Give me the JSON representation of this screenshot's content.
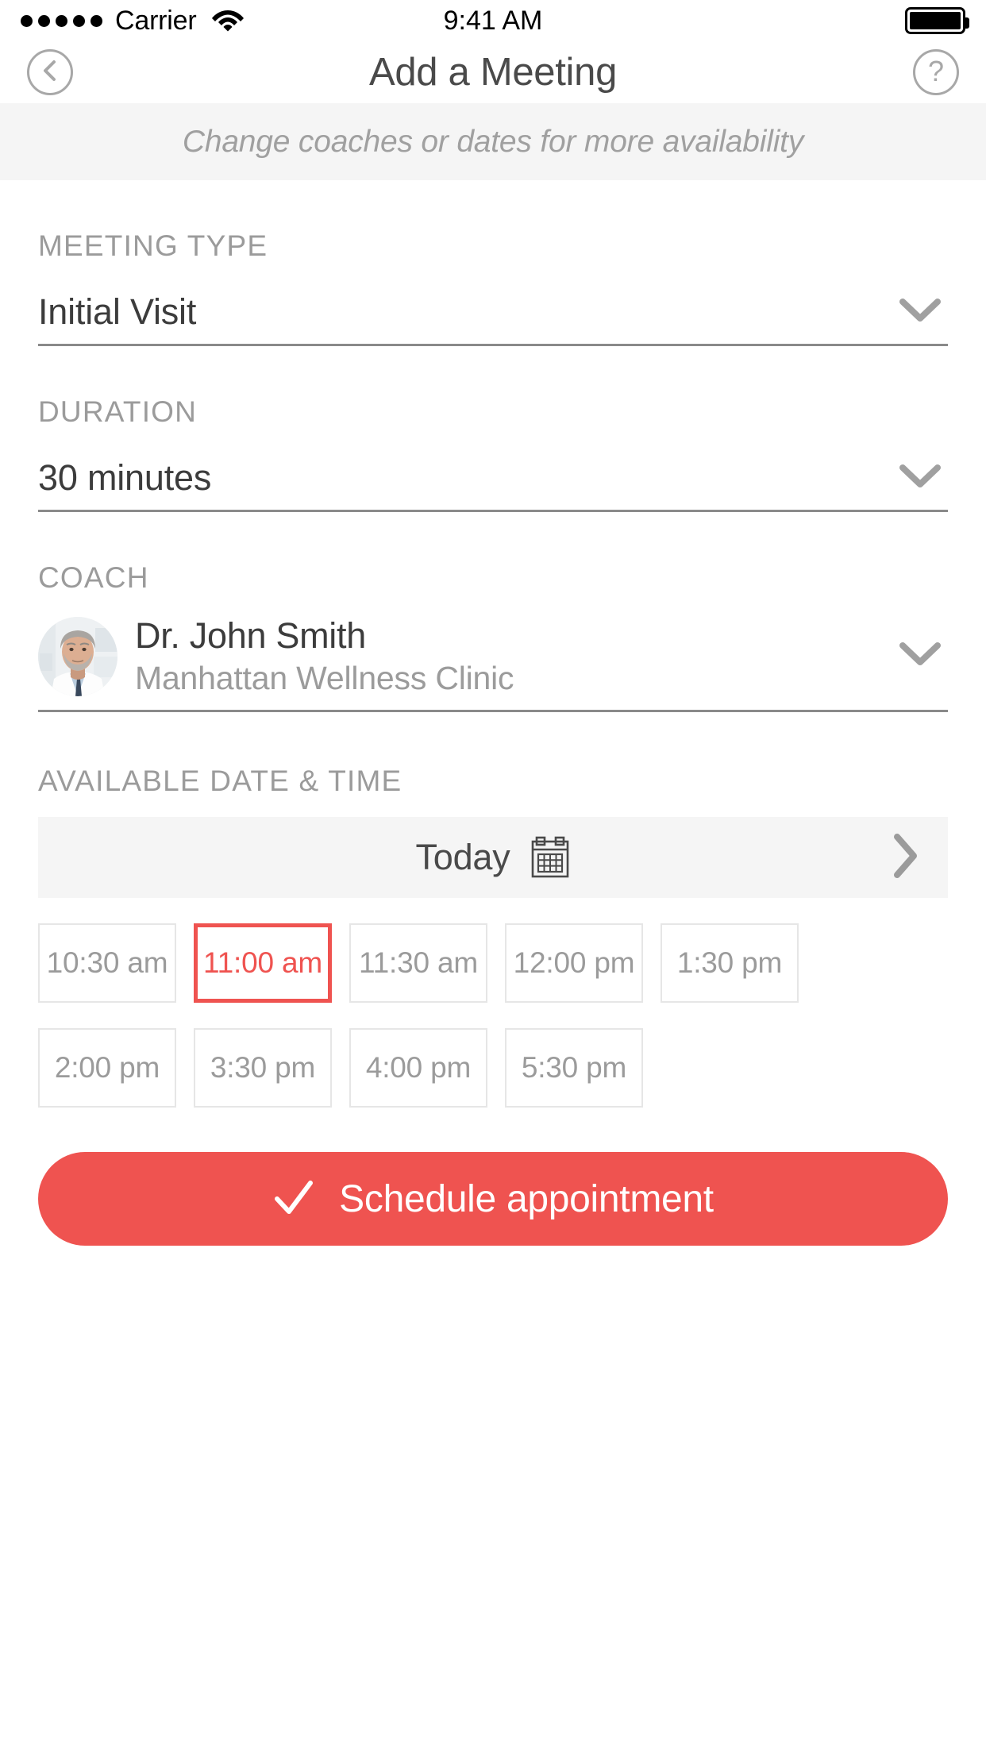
{
  "status_bar": {
    "carrier": "Carrier",
    "time": "9:41 AM",
    "signal_dots": 5,
    "wifi_icon": "wifi-icon",
    "battery_icon": "battery-full-icon"
  },
  "nav": {
    "back_icon": "chevron-left-circle-icon",
    "title": "Add a Meeting",
    "help_icon": "question-mark-circle-icon"
  },
  "banner": {
    "text": "Change coaches or dates for more availability"
  },
  "form": {
    "meeting_type": {
      "label": "MEETING TYPE",
      "value": "Initial Visit",
      "chevron_icon": "chevron-down-icon"
    },
    "duration": {
      "label": "DURATION",
      "value": "30 minutes",
      "chevron_icon": "chevron-down-icon"
    },
    "coach": {
      "label": "COACH",
      "name": "Dr. John Smith",
      "clinic": "Manhattan Wellness Clinic",
      "avatar_icon": "coach-avatar-photo",
      "chevron_icon": "chevron-down-icon"
    }
  },
  "availability": {
    "label": "AVAILABLE DATE & TIME",
    "date_label": "Today",
    "calendar_icon": "calendar-icon",
    "next_icon": "chevron-right-icon",
    "slots": [
      {
        "time": "10:30 am",
        "selected": false
      },
      {
        "time": "11:00 am",
        "selected": true
      },
      {
        "time": "11:30 am",
        "selected": false
      },
      {
        "time": "12:00 pm",
        "selected": false
      },
      {
        "time": "1:30 pm",
        "selected": false
      },
      {
        "time": "2:00 pm",
        "selected": false
      },
      {
        "time": "3:30 pm",
        "selected": false
      },
      {
        "time": "4:00 pm",
        "selected": false
      },
      {
        "time": "5:30 pm",
        "selected": false
      }
    ]
  },
  "cta": {
    "label": "Schedule appointment",
    "check_icon": "checkmark-icon"
  },
  "colors": {
    "accent": "#ef5350",
    "muted_text": "#9b9b9b",
    "primary_text": "#3c3c3c",
    "banner_bg": "#f5f5f5",
    "slot_border": "#e6e6e6"
  }
}
